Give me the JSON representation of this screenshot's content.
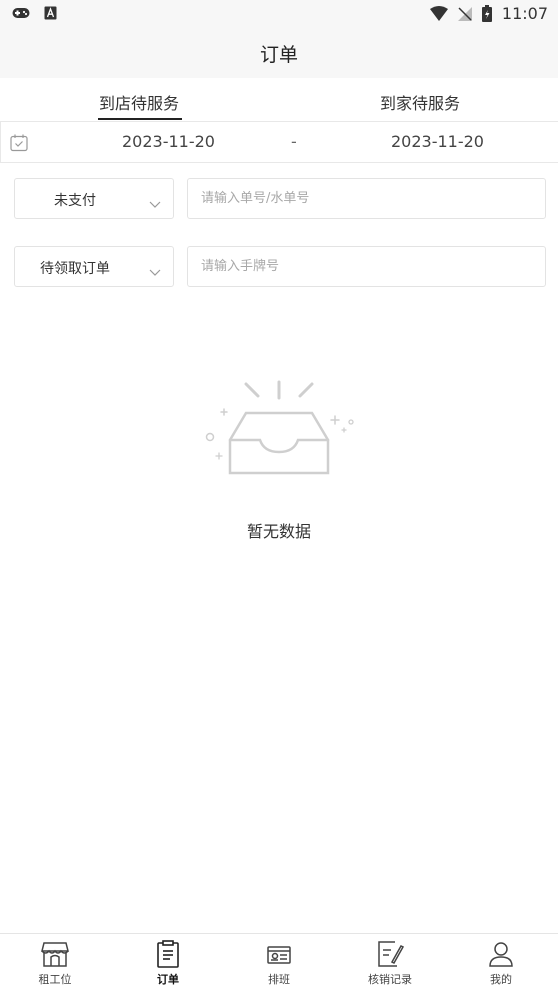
{
  "status_bar": {
    "time": "11:07",
    "left_icons": [
      "gamepad-icon",
      "a-box-icon"
    ],
    "right_icons": [
      "wifi-icon",
      "no-signal-icon",
      "battery-icon"
    ]
  },
  "header": {
    "title": "订单"
  },
  "tabs": [
    {
      "label": "到店待服务",
      "active": true
    },
    {
      "label": "到家待服务",
      "active": false
    }
  ],
  "date_range": {
    "start": "2023-11-20",
    "separator": "-",
    "end": "2023-11-20"
  },
  "filters": {
    "payment_status": "未支付",
    "order_no_placeholder": "请输入单号/水单号",
    "order_status": "待领取订单",
    "tag_placeholder": "请输入手牌号"
  },
  "empty_state": {
    "text": "暂无数据"
  },
  "tab_bar": [
    {
      "label": "租工位",
      "icon": "store-icon",
      "active": false
    },
    {
      "label": "订单",
      "icon": "clipboard-icon",
      "active": true
    },
    {
      "label": "排班",
      "icon": "schedule-icon",
      "active": false
    },
    {
      "label": "核销记录",
      "icon": "edit-record-icon",
      "active": false
    },
    {
      "label": "我的",
      "icon": "user-icon",
      "active": false
    }
  ],
  "colors": {
    "accent": "#222222",
    "divider": "#e8e8e8",
    "placeholder": "#a8a8a8"
  }
}
